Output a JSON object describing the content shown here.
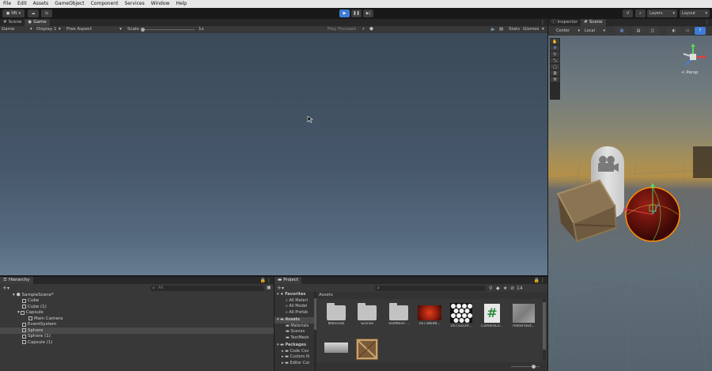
{
  "menu": [
    "File",
    "Edit",
    "Assets",
    "GameObject",
    "Component",
    "Services",
    "Window",
    "Help"
  ],
  "toolbar": {
    "account": "NN",
    "layers": "Layers",
    "layout": "Layout"
  },
  "game": {
    "tabs": [
      "Scene",
      "Game"
    ],
    "mode": "Game",
    "display": "Display 1",
    "aspect": "Free Aspect",
    "scale_label": "Scale",
    "scale_value": "1x",
    "play_focused": "Play Focused",
    "stats": "Stats",
    "gizmos": "Gizmos"
  },
  "hierarchy": {
    "title": "Hierarchy",
    "search_placeholder": "All",
    "scene": "SampleScene*",
    "items": [
      {
        "label": "Cube",
        "indent": 1
      },
      {
        "label": "Cube (1)",
        "indent": 1
      },
      {
        "label": "Capsule",
        "indent": 1
      },
      {
        "label": "Main Camera",
        "indent": 2
      },
      {
        "label": "EventSystem",
        "indent": 1
      },
      {
        "label": "Sphere",
        "indent": 1
      },
      {
        "label": "Sphere (1)",
        "indent": 1
      },
      {
        "label": "Capsule (1)",
        "indent": 1
      }
    ]
  },
  "project": {
    "title": "Project",
    "count": "14",
    "favorites": "Favorites",
    "fav_items": [
      "All Materi",
      "All Model",
      "All Prefab"
    ],
    "assets_root": "Assets",
    "asset_items": [
      "Materials",
      "Scenes",
      "TextMesh"
    ],
    "packages": "Packages",
    "package_items": [
      "Code Cov",
      "Custom N",
      "Editor Cor"
    ],
    "breadcrumb": "Assets",
    "assets": [
      {
        "label": "Materials",
        "type": "folder"
      },
      {
        "label": "Scenes",
        "type": "folder"
      },
      {
        "label": "TextMesh ...",
        "type": "folder"
      },
      {
        "label": "16738648...",
        "type": "texture-red"
      },
      {
        "label": "16733229...",
        "type": "texture-hex"
      },
      {
        "label": "CameraCo...",
        "type": "script"
      },
      {
        "label": "metal-text...",
        "type": "texture-metal"
      },
      {
        "label": "",
        "type": "texture-gradient"
      },
      {
        "label": "",
        "type": "texture-crate"
      }
    ]
  },
  "right": {
    "tabs": [
      "Inspector",
      "Scene"
    ],
    "pivot": "Center",
    "space": "Local",
    "persp": "< Persp"
  },
  "colors": {
    "play_accent": "#3d7dd6",
    "selection": "#ff8a00"
  }
}
